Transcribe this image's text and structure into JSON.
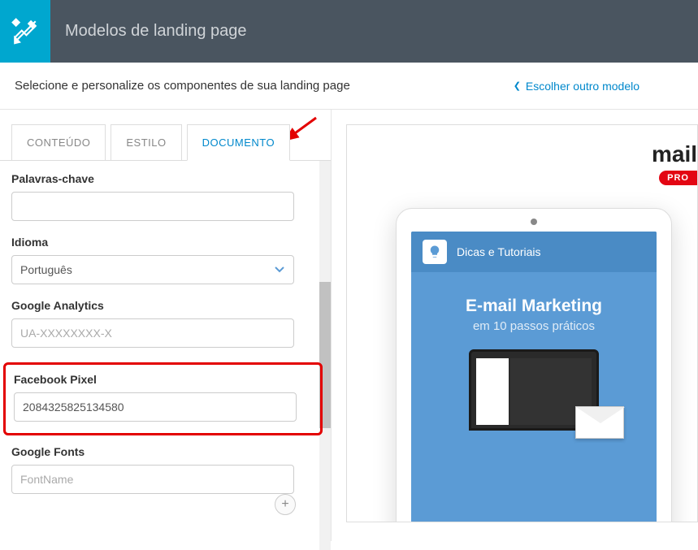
{
  "header": {
    "title": "Modelos de landing page"
  },
  "subheader": {
    "text": "Selecione e personalize os componentes de sua landing page",
    "link_text": "Escolher outro modelo"
  },
  "tabs": {
    "content": "CONTEÚDO",
    "style": "ESTILO",
    "document": "DOCUMENTO"
  },
  "form": {
    "keywords": {
      "label": "Palavras-chave",
      "value": ""
    },
    "language": {
      "label": "Idioma",
      "value": "Português"
    },
    "analytics": {
      "label": "Google Analytics",
      "placeholder": "UA-XXXXXXXX-X",
      "value": ""
    },
    "fbpixel": {
      "label": "Facebook Pixel",
      "value": "2084325825134580"
    },
    "fonts": {
      "label": "Google Fonts",
      "placeholder": "FontName",
      "value": ""
    }
  },
  "preview": {
    "logo_text": "mail",
    "logo_badge": "PRO",
    "screen_header": "Dicas e Tutoriais",
    "screen_title": "E-mail Marketing",
    "screen_subtitle": "em 10 passos práticos"
  }
}
